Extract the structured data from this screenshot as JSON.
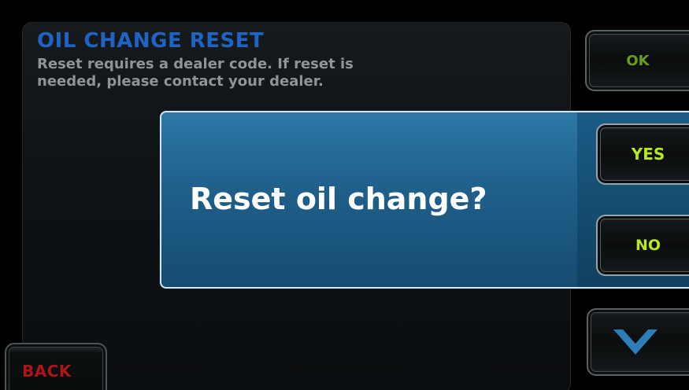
{
  "info": {
    "title": "OIL CHANGE RESET",
    "body": "Reset requires a dealer code. If reset is\nneeded, please contact your dealer."
  },
  "buttons": {
    "ok_label": "OK",
    "back_label": "BACK",
    "down_icon": "chevron-down-icon"
  },
  "dialog": {
    "question": "Reset oil change?",
    "yes_label": "YES",
    "no_label": "NO"
  },
  "colors": {
    "title_blue": "#1f63c4",
    "dialog_blue": "#1f5f8a",
    "accent_green": "#b7ea1c",
    "back_red": "#b01414",
    "chevron_blue": "#2b7fb8"
  }
}
